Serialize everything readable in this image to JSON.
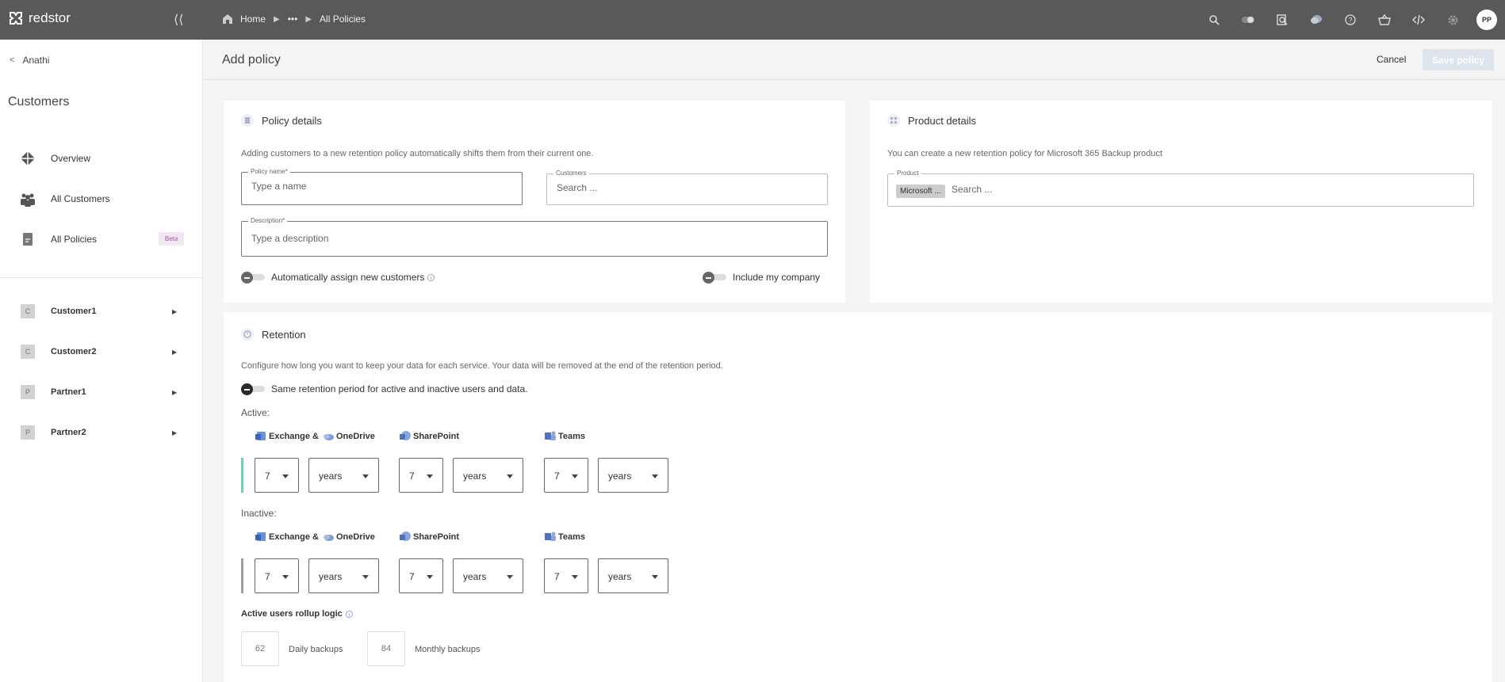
{
  "app": {
    "brand": "redstor"
  },
  "breadcrumb": {
    "home": "Home",
    "ellipsis": "•••",
    "current": "All Policies"
  },
  "topbar": {
    "icons": [
      "search-icon",
      "toggle-icon",
      "inspect-icon",
      "chat-icon",
      "help-icon",
      "basket-icon",
      "code-icon",
      "gear-icon"
    ],
    "avatar": "PP"
  },
  "sidebar": {
    "back_label": "Anathi",
    "title": "Customers",
    "nav": [
      {
        "label": "Overview",
        "icon": "overview-icon"
      },
      {
        "label": "All Customers",
        "icon": "customers-icon"
      },
      {
        "label": "All Policies",
        "icon": "policy-icon",
        "badge": "Beta"
      }
    ],
    "customers": [
      {
        "initial": "C",
        "label": "Customer1"
      },
      {
        "initial": "C",
        "label": "Customer2"
      },
      {
        "initial": "P",
        "label": "Partner1"
      },
      {
        "initial": "P",
        "label": "Partner2"
      }
    ]
  },
  "header": {
    "title": "Add policy",
    "cancel": "Cancel",
    "save": "Save policy"
  },
  "policy_details": {
    "title": "Policy details",
    "hint": "Adding customers to a new retention policy automatically shifts them from their current one.",
    "policy_name": {
      "label": "Policy name*",
      "placeholder": "Type a name",
      "value": ""
    },
    "customers": {
      "label": "Customers",
      "placeholder": "Search ...",
      "value": ""
    },
    "description": {
      "label": "Description*",
      "placeholder": "Type a description",
      "value": ""
    },
    "auto_assign_label": "Automatically assign new customers",
    "auto_assign": false,
    "include_company_label": "Include my company",
    "include_company": false
  },
  "product_details": {
    "title": "Product details",
    "hint": "You can create a new retention policy for Microsoft 365 Backup product",
    "product": {
      "label": "Product",
      "chip": "Microsoft ...",
      "placeholder": "Search ...",
      "value": ""
    }
  },
  "retention": {
    "title": "Retention",
    "hint": "Configure how long you want to keep your data for each service. Your data will be removed at the end of the retention period.",
    "same_period_label": "Same retention period for active and inactive users and data.",
    "same_period": false,
    "active": {
      "label": "Active:",
      "bar_color": "#6fd2b0",
      "services": [
        {
          "name": "Exchange & ",
          "name2": "OneDrive",
          "amount": "7",
          "unit": "years"
        },
        {
          "name": "SharePoint",
          "amount": "7",
          "unit": "years"
        },
        {
          "name": "Teams",
          "amount": "7",
          "unit": "years"
        }
      ]
    },
    "inactive": {
      "label": "Inactive:",
      "bar_color": "#9e9e9e",
      "services": [
        {
          "name": "Exchange & ",
          "name2": "OneDrive",
          "amount": "7",
          "unit": "years"
        },
        {
          "name": "SharePoint",
          "amount": "7",
          "unit": "years"
        },
        {
          "name": "Teams",
          "amount": "7",
          "unit": "years"
        }
      ]
    },
    "rollup": {
      "label": "Active users rollup logic",
      "daily": {
        "value": "62",
        "label": "Daily backups"
      },
      "monthly": {
        "value": "84",
        "label": "Monthly backups"
      }
    }
  }
}
